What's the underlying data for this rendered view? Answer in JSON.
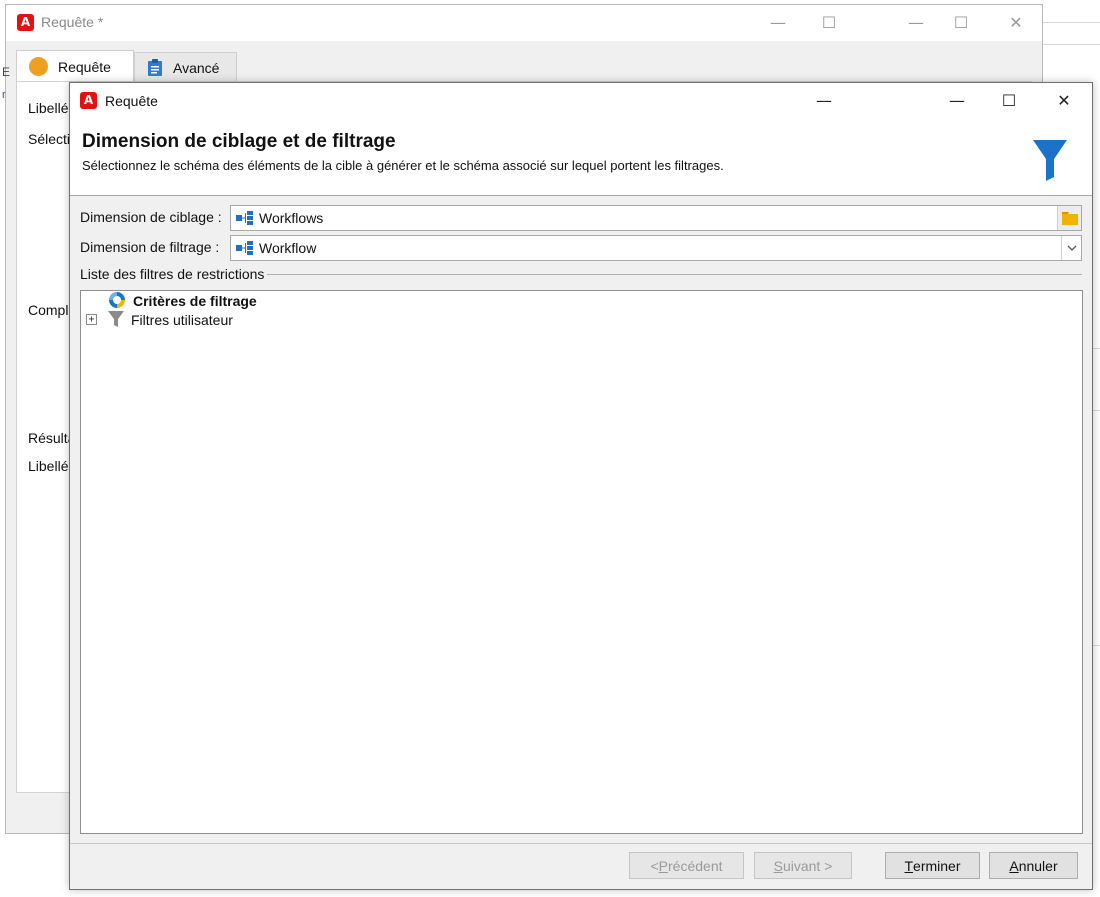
{
  "back_window": {
    "title": "Requête *",
    "tabs": [
      {
        "label": "Requête",
        "active": true,
        "icon": "orange-circle-icon"
      },
      {
        "label": "Avancé",
        "active": false,
        "icon": "clipboard-icon"
      }
    ],
    "labels": [
      "Libellé",
      "Sélectio",
      "Compl",
      "Résulta",
      "Libellé"
    ],
    "left_edge_e": "E",
    "left_edge_link": "r"
  },
  "dialog": {
    "title": "Requête",
    "header": {
      "title": "Dimension de ciblage et de filtrage",
      "subtitle": "Sélectionnez le schéma des éléments de la cible à générer et le schéma associé sur lequel portent les filtrages."
    },
    "targeting": {
      "label": "Dimension de ciblage :",
      "value": "Workflows"
    },
    "filtering": {
      "label": "Dimension de filtrage :",
      "value": "Workflow"
    },
    "restrictions": {
      "group_title": "Liste des filtres de restrictions",
      "items": [
        {
          "label": "Critères de filtrage",
          "bold": true,
          "icon": "filter-criteria-icon"
        },
        {
          "label": "Filtres utilisateur",
          "bold": false,
          "icon": "funnel-icon",
          "expander": "+"
        }
      ]
    },
    "buttons": {
      "previous": {
        "prefix": "< ",
        "mnemonic": "P",
        "rest": "récédent",
        "enabled": false
      },
      "next": {
        "mnemonic": "S",
        "rest": "uivant >",
        "enabled": false
      },
      "finish": {
        "mnemonic": "T",
        "rest": "erminer",
        "enabled": true
      },
      "cancel": {
        "mnemonic": "A",
        "rest": "nnuler",
        "enabled": true
      }
    }
  },
  "window_controls": {
    "minimize": "—",
    "maximize": "☐",
    "close": "✕"
  },
  "colors": {
    "adobe_red": "#e31212",
    "funnel_blue": "#1a73c8",
    "folder_yellow": "#f0b400",
    "tab_orange": "#f0a020"
  }
}
